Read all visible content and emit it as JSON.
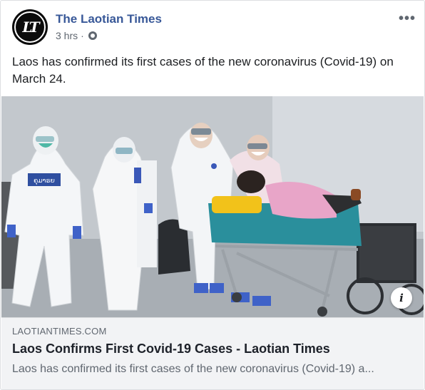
{
  "post": {
    "page_name": "The Laotian Times",
    "avatar_text": "LT",
    "timestamp": "3 hrs",
    "separator": "·",
    "audience_icon": "globe-icon",
    "more_icon": "•••",
    "text": "Laos has confirmed its first cases of the new coronavirus (Covid-19) on March 24."
  },
  "link_preview": {
    "domain": "LAOTIANTIMES.COM",
    "title": "Laos Confirms First Covid-19 Cases - Laotian Times",
    "description": "Laos has confirmed its first cases of the new coronavirus (Covid-19) a...",
    "info_icon": "i"
  },
  "photo": {
    "badge_text": "ຄຸມາຣຍ"
  },
  "colors": {
    "page_name": "#385898",
    "secondary_text": "#606770",
    "link_box_bg": "#f2f3f5",
    "suit_white": "#f4f6f8",
    "stretcher_yellow": "#f2c21a",
    "stretcher_teal": "#2a8f9c",
    "patient_pink": "#e8a5c8"
  }
}
